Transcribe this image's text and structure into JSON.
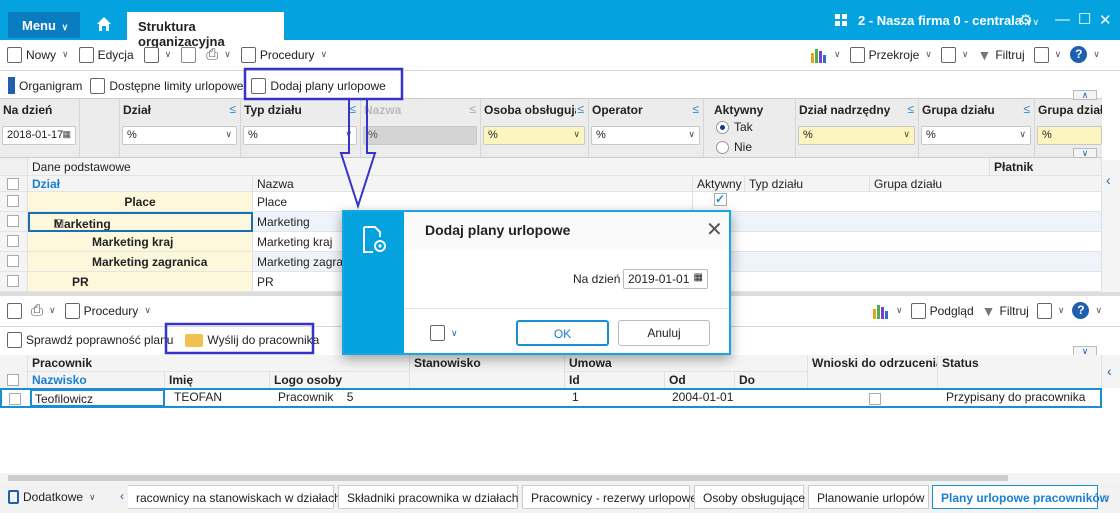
{
  "titlebar": {
    "menu": "Menu",
    "tab": "Struktura organizacyjna",
    "firm": "2 - Nasza firma 0 - centrala"
  },
  "toolbar1": {
    "new": "Nowy",
    "edit": "Edycja",
    "procedures": "Procedury",
    "sections": "Przekroje",
    "filter": "Filtruj"
  },
  "toolbar2": {
    "orgchart": "Organigram",
    "limits": "Dostępne limity urlopowe",
    "add_plans": "Dodaj plany urlopowe"
  },
  "filters": {
    "date_label": "Na dzień",
    "date_value": "2018-01-17",
    "cols": [
      {
        "label": "Dział",
        "value": "%"
      },
      {
        "label": "Typ działu",
        "value": "%"
      },
      {
        "label": "Nazwa",
        "value": "%"
      },
      {
        "label": "Osoba obsługując",
        "value": "%"
      },
      {
        "label": "Operator",
        "value": "%"
      },
      {
        "label": "Dział nadrzędny",
        "value": "%"
      },
      {
        "label": "Grupa działu",
        "value": "%"
      },
      {
        "label": "Grupa działu",
        "value": "%"
      }
    ],
    "active_label": "Aktywny",
    "active_yes": "Tak",
    "active_no": "Nie"
  },
  "upper_grid": {
    "group": "Dane podstawowe",
    "payer": "Płatnik",
    "headers": {
      "dzial": "Dział",
      "nazwa": "Nazwa",
      "aktywny": "Aktywny",
      "typ": "Typ działu",
      "grupa": "Grupa działu"
    },
    "rows": [
      {
        "dzial": "Place",
        "nazwa": "Place",
        "active": true
      },
      {
        "dzial": "Marketing",
        "nazwa": "Marketing"
      },
      {
        "dzial": "Marketing kraj",
        "nazwa": "Marketing kraj"
      },
      {
        "dzial": "Marketing zagranica",
        "nazwa": "Marketing zagranica"
      },
      {
        "dzial": "PR",
        "nazwa": "PR"
      }
    ]
  },
  "lower_toolbar": {
    "procedures": "Procedury",
    "preview": "Podgląd",
    "filter": "Filtruj",
    "check": "Sprawdź poprawność planu",
    "send": "Wyślij do pracownika"
  },
  "lower_grid": {
    "groups": {
      "pracownik": "Pracownik",
      "stanowisko": "Stanowisko",
      "umowa": "Umowa",
      "wnioski": "Wnioski do odrzucenia",
      "status": "Status"
    },
    "headers": {
      "nazwisko": "Nazwisko",
      "imie": "Imię",
      "logo": "Logo osoby",
      "id": "Id",
      "od": "Od",
      "do": "Do"
    },
    "rows": [
      {
        "nazwisko": "Teofilowicz",
        "imie": "TEOFAN",
        "logo": "Pracownik    5",
        "id": "1",
        "od": "2004-01-01",
        "do": "",
        "status": "Przypisany do pracownika"
      }
    ]
  },
  "dialog": {
    "title": "Dodaj plany urlopowe",
    "date_label": "Na dzień",
    "date_value": "2019-01-01",
    "ok": "OK",
    "cancel": "Anuluj"
  },
  "bottom": {
    "extra": "Dodatkowe",
    "tabs": [
      "racownicy na stanowiskach w działach",
      "Składniki pracownika w działach",
      "Pracownicy - rezerwy urlopowe",
      "Osoby obsługujące",
      "Planowanie urlopów",
      "Plany urlopowe pracowników"
    ]
  },
  "colors": {
    "accent": "#04a3e0",
    "annotation": "#3434c8"
  }
}
